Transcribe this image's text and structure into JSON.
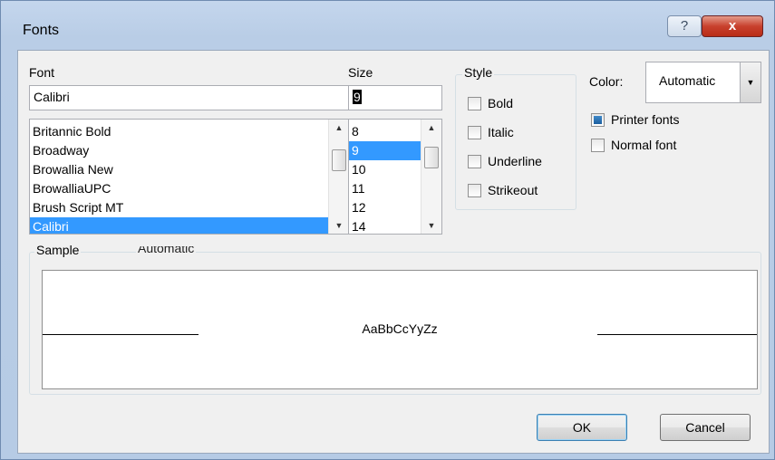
{
  "window": {
    "title": "Fonts",
    "help_glyph": "?",
    "close_glyph": "x"
  },
  "font": {
    "label": "Font",
    "value": "Calibri",
    "items": [
      "Britannic Bold",
      "Broadway",
      "Browallia New",
      "BrowalliaUPC",
      "Brush Script MT",
      "Calibri"
    ],
    "selected": "Calibri"
  },
  "size": {
    "label": "Size",
    "value": "9",
    "items": [
      "8",
      "9",
      "10",
      "11",
      "12",
      "14"
    ],
    "selected": "9"
  },
  "style": {
    "label": "Style",
    "bold": "Bold",
    "italic": "Italic",
    "underline": "Underline",
    "strikeout": "Strikeout"
  },
  "color": {
    "label": "Color:",
    "value": "Automatic"
  },
  "options": {
    "printer_fonts": {
      "label": "Printer fonts",
      "checked": true
    },
    "normal_font": {
      "label": "Normal font",
      "checked": false
    }
  },
  "sample": {
    "label": "Sample",
    "overlap_text": "Automatic",
    "preview_text": "AaBbCcYyZz"
  },
  "buttons": {
    "ok": "OK",
    "cancel": "Cancel"
  },
  "icons": {
    "scroll_up": "up-arrow-icon",
    "scroll_down": "down-arrow-icon",
    "dropdown": "chevron-down-icon"
  },
  "colors": {
    "selection": "#3399ff",
    "close_button": "#c8412d",
    "checkbox_fill": "#2a72b5"
  }
}
